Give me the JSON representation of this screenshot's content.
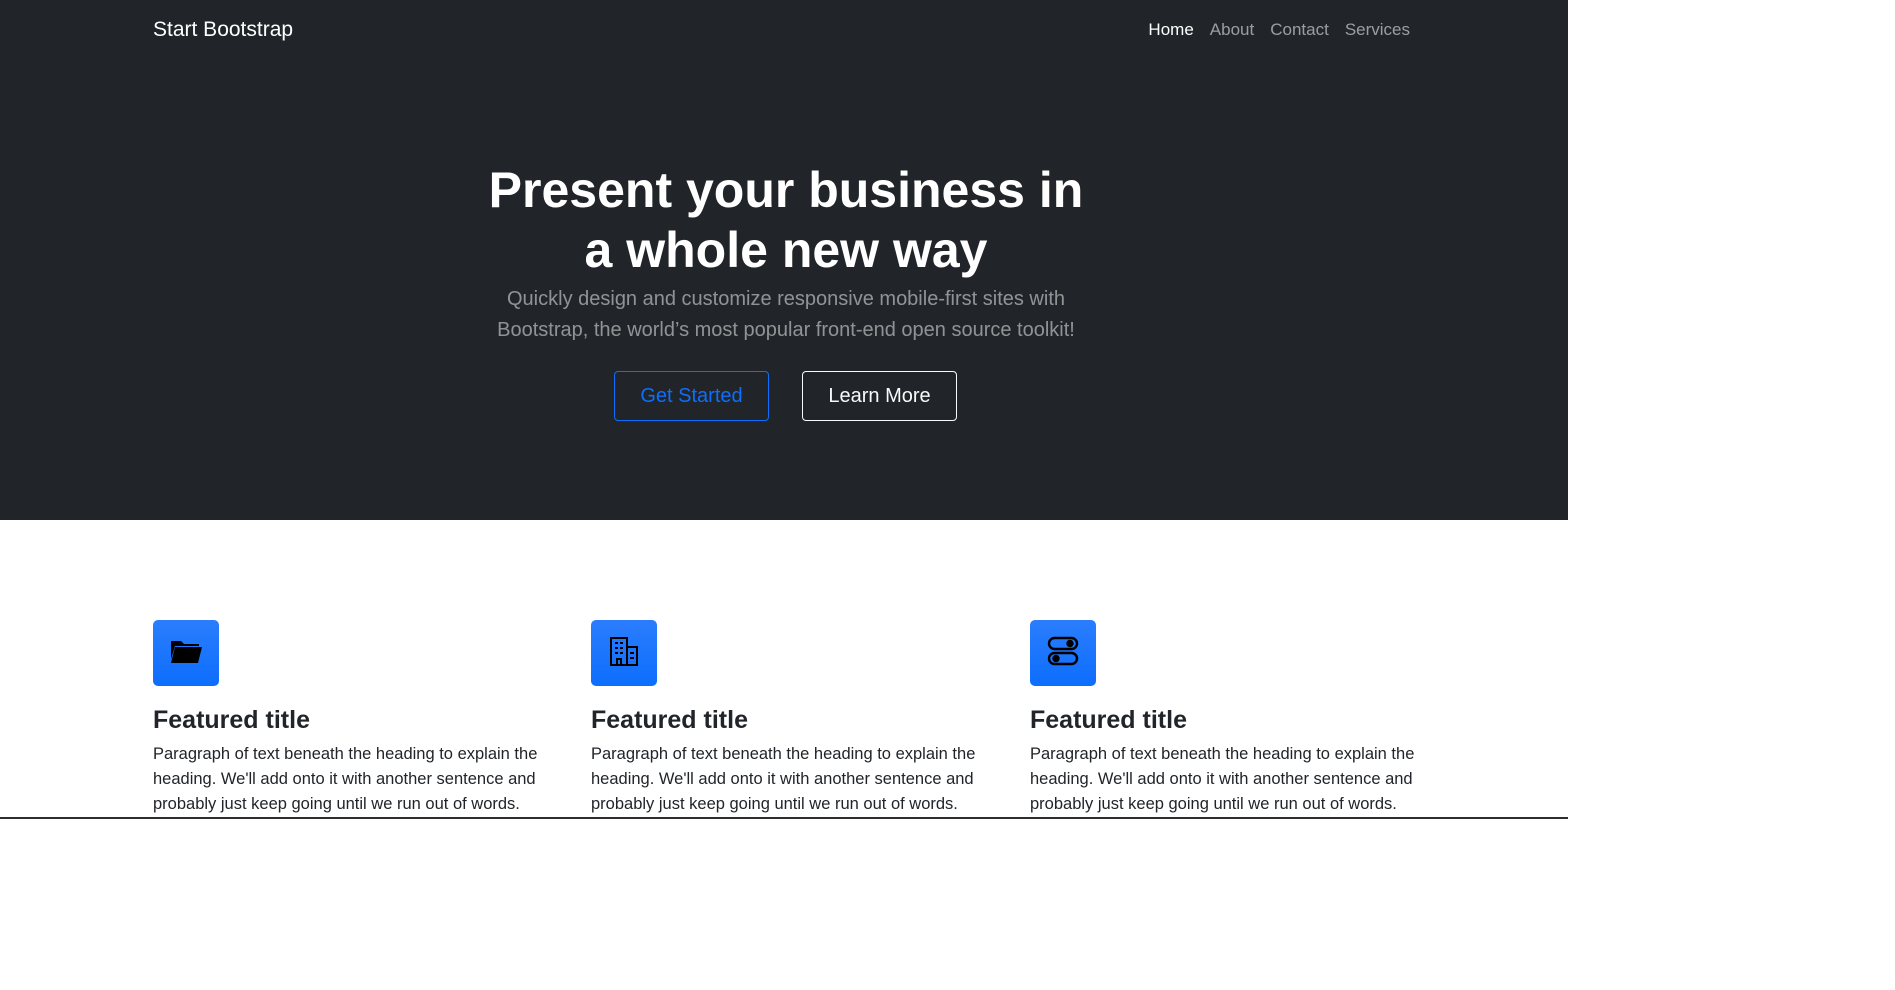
{
  "navbar": {
    "brand": "Start Bootstrap",
    "links": [
      {
        "label": "Home",
        "active": true
      },
      {
        "label": "About",
        "active": false
      },
      {
        "label": "Contact",
        "active": false
      },
      {
        "label": "Services",
        "active": false
      }
    ]
  },
  "hero": {
    "title": "Present your business in a whole new way",
    "lead": "Quickly design and customize responsive mobile-first sites with Bootstrap, the world’s most popular front-end open source toolkit!",
    "primary_button": "Get Started",
    "secondary_button": "Learn More"
  },
  "features": [
    {
      "icon": "folder-icon",
      "title": "Featured title",
      "text": "Paragraph of text beneath the heading to explain the heading. We'll add onto it with another sentence and probably just keep going until we run out of words."
    },
    {
      "icon": "building-icon",
      "title": "Featured title",
      "text": "Paragraph of text beneath the heading to explain the heading. We'll add onto it with another sentence and probably just keep going until we run out of words."
    },
    {
      "icon": "toggles-icon",
      "title": "Featured title",
      "text": "Paragraph of text beneath the heading to explain the heading. We'll add onto it with another sentence and probably just keep going until we run out of words."
    }
  ],
  "colors": {
    "dark": "#212529",
    "primary": "#0d6efd",
    "white": "#ffffff"
  }
}
